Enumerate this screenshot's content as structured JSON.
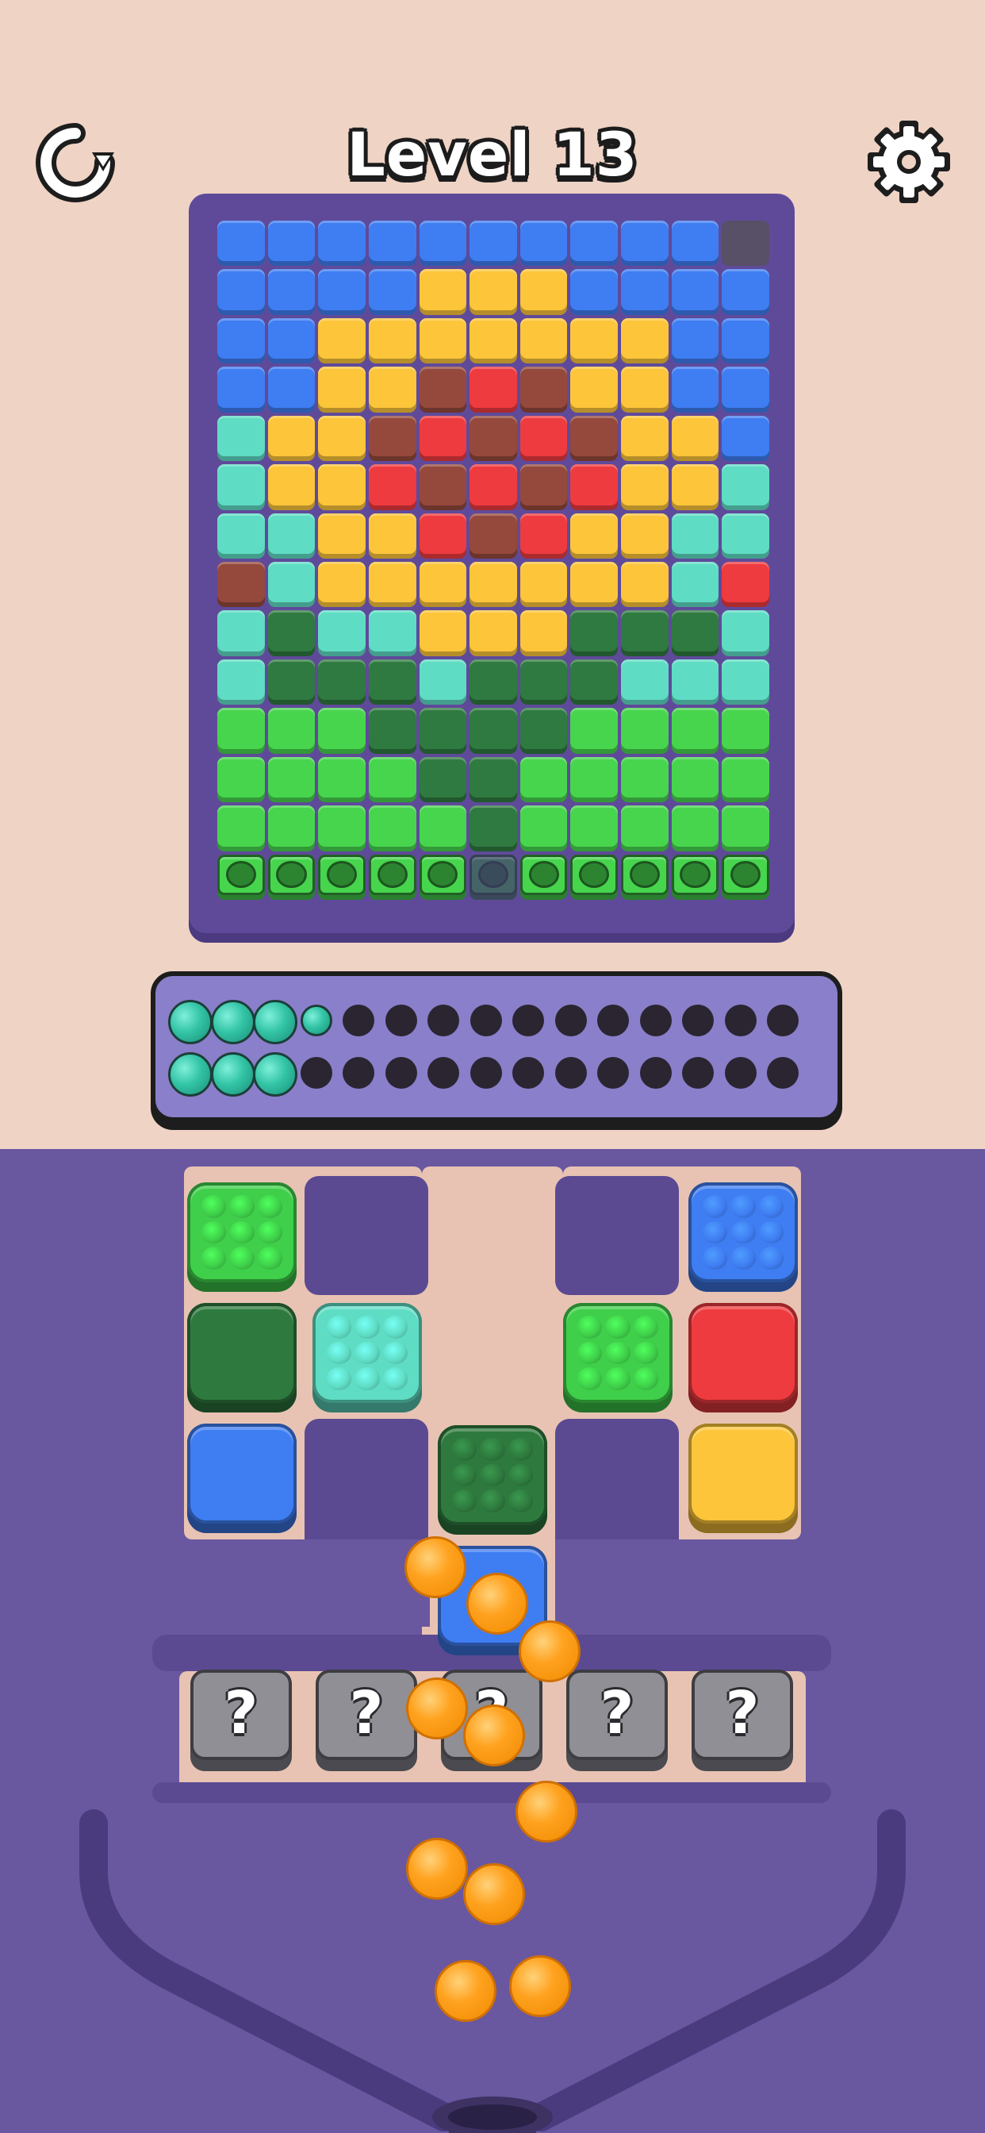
{
  "header": {
    "title": "Level 13",
    "restart_icon": "restart-icon",
    "settings_icon": "gear-icon"
  },
  "board": {
    "rows": 14,
    "cols": 11,
    "palette": {
      "B": "#3f7df2",
      "Y": "#fcc53a",
      "R": "#ee3b3f",
      "W": "#95493c",
      "T": "#5fdcc4",
      "D": "#2f7a40",
      "G": "#47d54e",
      "E": "#575066"
    },
    "grid": [
      "BBBBBBBBBBE",
      "BBBBYYYBBBB",
      "BBYYYYYYYBB",
      "BBYYWRWYYBB",
      "TYYWRWRWYYB",
      "TYYRWRWRYYT",
      "TTYYRWRYYTT",
      "WTYYYYYYYTR",
      "TDTTYYYDDDT",
      "TDDDTDDDTTT",
      "GGGDDDDGGGG",
      "GGGGDDGGGGG",
      "GGGGGDGGGGG",
      "GGGGGDGGGGG"
    ],
    "bottom_row_holes": true
  },
  "tray": {
    "columns": 15,
    "row1_filled": 3,
    "row1_small": 1,
    "row2_filled": 3,
    "ball_color": "teal"
  },
  "blocks": [
    {
      "color": "#3fcf4a",
      "textured": true
    },
    {
      "color": "#2e7a3e",
      "textured": false
    },
    {
      "color": "#3f7df2",
      "textured": false
    },
    {
      "color": "#5fdcc4",
      "textured": true
    },
    {
      "color": "#2e7a3e",
      "textured": true
    },
    {
      "color": "#3f7df2",
      "textured": false
    },
    {
      "color": "#3fcf4a",
      "textured": true
    },
    {
      "color": "#3f7df2",
      "textured": true
    },
    {
      "color": "#ee3b3f",
      "textured": false
    },
    {
      "color": "#fcc53a",
      "textured": false
    }
  ],
  "mystery": {
    "label": "?",
    "count": 5
  },
  "orange_balls": 10
}
